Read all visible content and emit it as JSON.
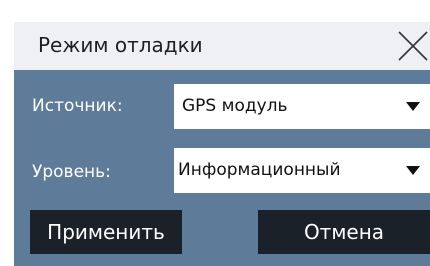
{
  "dialog": {
    "title": "Режим отладки",
    "close_icon": "close-icon"
  },
  "fields": {
    "source": {
      "label": "Источник:",
      "value": "GPS модуль"
    },
    "level": {
      "label": "Уровень:",
      "value": "Информационный"
    }
  },
  "buttons": {
    "apply": "Применить",
    "cancel": "Отмена"
  },
  "colors": {
    "panel": "#5f7b9a",
    "titlebar": "#eff0f3",
    "button": "#1a2129"
  }
}
